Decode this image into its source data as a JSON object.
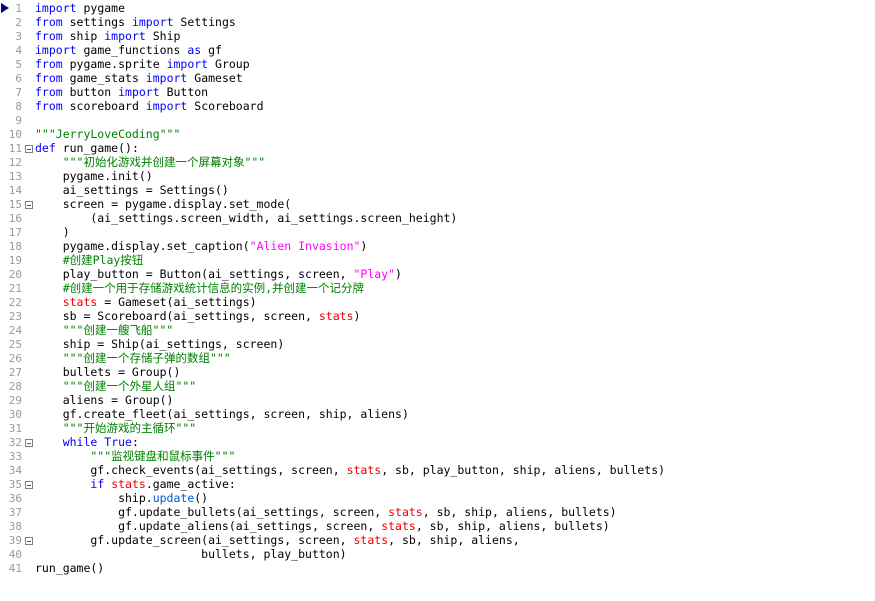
{
  "editor": {
    "language": "Python",
    "total_lines": 41,
    "colors": {
      "background": "#ffffff",
      "line_number": "#999999",
      "keyword": "#0000ff",
      "string": "#ff00ff",
      "comment": "#008000",
      "error_highlight": "#ee0000",
      "method": "#0055dd",
      "plain_text": "#000000",
      "breakpoint_arrow": "#000080"
    },
    "markers": {
      "current_line_arrow": 1,
      "fold_lines": [
        11,
        15,
        32,
        35,
        39
      ]
    },
    "lines": [
      {
        "n": 1,
        "fold": false,
        "tokens": [
          {
            "t": "import",
            "c": "kw"
          },
          {
            "t": " pygame",
            "c": "pln"
          }
        ]
      },
      {
        "n": 2,
        "fold": false,
        "tokens": [
          {
            "t": "from",
            "c": "kw"
          },
          {
            "t": " settings ",
            "c": "pln"
          },
          {
            "t": "import",
            "c": "kw"
          },
          {
            "t": " Settings",
            "c": "pln"
          }
        ]
      },
      {
        "n": 3,
        "fold": false,
        "tokens": [
          {
            "t": "from",
            "c": "kw"
          },
          {
            "t": " ship ",
            "c": "pln"
          },
          {
            "t": "import",
            "c": "kw"
          },
          {
            "t": " Ship",
            "c": "pln"
          }
        ]
      },
      {
        "n": 4,
        "fold": false,
        "tokens": [
          {
            "t": "import",
            "c": "kw"
          },
          {
            "t": " game_functions ",
            "c": "pln"
          },
          {
            "t": "as",
            "c": "kw"
          },
          {
            "t": " gf",
            "c": "pln"
          }
        ]
      },
      {
        "n": 5,
        "fold": false,
        "tokens": [
          {
            "t": "from",
            "c": "kw"
          },
          {
            "t": " pygame.sprite ",
            "c": "pln"
          },
          {
            "t": "import",
            "c": "kw"
          },
          {
            "t": " Group",
            "c": "pln"
          }
        ]
      },
      {
        "n": 6,
        "fold": false,
        "tokens": [
          {
            "t": "from",
            "c": "kw"
          },
          {
            "t": " game_stats ",
            "c": "pln"
          },
          {
            "t": "import",
            "c": "kw"
          },
          {
            "t": " Gameset",
            "c": "pln"
          }
        ]
      },
      {
        "n": 7,
        "fold": false,
        "tokens": [
          {
            "t": "from",
            "c": "kw"
          },
          {
            "t": " button ",
            "c": "pln"
          },
          {
            "t": "import",
            "c": "kw"
          },
          {
            "t": " Button",
            "c": "pln"
          }
        ]
      },
      {
        "n": 8,
        "fold": false,
        "tokens": [
          {
            "t": "from",
            "c": "kw"
          },
          {
            "t": " scoreboard ",
            "c": "pln"
          },
          {
            "t": "import",
            "c": "kw"
          },
          {
            "t": " Scoreboard",
            "c": "pln"
          }
        ]
      },
      {
        "n": 9,
        "fold": false,
        "tokens": []
      },
      {
        "n": 10,
        "fold": false,
        "tokens": [
          {
            "t": "\"\"\"JerryLoveCoding\"\"\"",
            "c": "doc"
          }
        ]
      },
      {
        "n": 11,
        "fold": true,
        "tokens": [
          {
            "t": "def",
            "c": "kw"
          },
          {
            "t": " run_game():",
            "c": "pln"
          }
        ]
      },
      {
        "n": 12,
        "fold": false,
        "tokens": [
          {
            "t": "    \"\"\"初始化游戏并创建一个屏幕对象\"\"\"",
            "c": "doc"
          }
        ]
      },
      {
        "n": 13,
        "fold": false,
        "tokens": [
          {
            "t": "    pygame.init()",
            "c": "pln"
          }
        ]
      },
      {
        "n": 14,
        "fold": false,
        "tokens": [
          {
            "t": "    ai_settings = Settings()",
            "c": "pln"
          }
        ]
      },
      {
        "n": 15,
        "fold": true,
        "tokens": [
          {
            "t": "    screen = pygame.display.set_mode(",
            "c": "pln"
          }
        ]
      },
      {
        "n": 16,
        "fold": false,
        "tokens": [
          {
            "t": "        (ai_settings.screen_width, ai_settings.screen_height)",
            "c": "pln"
          }
        ]
      },
      {
        "n": 17,
        "fold": false,
        "tokens": [
          {
            "t": "    )",
            "c": "pln"
          }
        ]
      },
      {
        "n": 18,
        "fold": false,
        "tokens": [
          {
            "t": "    pygame.display.set_caption(",
            "c": "pln"
          },
          {
            "t": "\"Alien Invasion\"",
            "c": "str"
          },
          {
            "t": ")",
            "c": "pln"
          }
        ]
      },
      {
        "n": 19,
        "fold": false,
        "tokens": [
          {
            "t": "    #创建Play按钮",
            "c": "cmt"
          }
        ]
      },
      {
        "n": 20,
        "fold": false,
        "tokens": [
          {
            "t": "    play_button = Button(ai_settings, screen, ",
            "c": "pln"
          },
          {
            "t": "\"Play\"",
            "c": "str"
          },
          {
            "t": ")",
            "c": "pln"
          }
        ]
      },
      {
        "n": 21,
        "fold": false,
        "tokens": [
          {
            "t": "    #创建一个用于存储游戏统计信息的实例,并创建一个记分牌",
            "c": "cmt"
          }
        ]
      },
      {
        "n": 22,
        "fold": false,
        "tokens": [
          {
            "t": "    ",
            "c": "pln"
          },
          {
            "t": "stats",
            "c": "err"
          },
          {
            "t": " = Gameset(ai_settings)",
            "c": "pln"
          }
        ]
      },
      {
        "n": 23,
        "fold": false,
        "tokens": [
          {
            "t": "    sb = Scoreboard(ai_settings, screen, ",
            "c": "pln"
          },
          {
            "t": "stats",
            "c": "err"
          },
          {
            "t": ")",
            "c": "pln"
          }
        ]
      },
      {
        "n": 24,
        "fold": false,
        "tokens": [
          {
            "t": "    \"\"\"创建一艘飞船\"\"\"",
            "c": "doc"
          }
        ]
      },
      {
        "n": 25,
        "fold": false,
        "tokens": [
          {
            "t": "    ship = Ship(ai_settings, screen)",
            "c": "pln"
          }
        ]
      },
      {
        "n": 26,
        "fold": false,
        "tokens": [
          {
            "t": "    \"\"\"创建一个存储子弹的数组\"\"\"",
            "c": "doc"
          }
        ]
      },
      {
        "n": 27,
        "fold": false,
        "tokens": [
          {
            "t": "    bullets = Group()",
            "c": "pln"
          }
        ]
      },
      {
        "n": 28,
        "fold": false,
        "tokens": [
          {
            "t": "    \"\"\"创建一个外星人组\"\"\"",
            "c": "doc"
          }
        ]
      },
      {
        "n": 29,
        "fold": false,
        "tokens": [
          {
            "t": "    aliens = Group()",
            "c": "pln"
          }
        ]
      },
      {
        "n": 30,
        "fold": false,
        "tokens": [
          {
            "t": "    gf.create_fleet(ai_settings, screen, ship, aliens)",
            "c": "pln"
          }
        ]
      },
      {
        "n": 31,
        "fold": false,
        "tokens": [
          {
            "t": "    \"\"\"开始游戏的主循环\"\"\"",
            "c": "doc"
          }
        ]
      },
      {
        "n": 32,
        "fold": true,
        "tokens": [
          {
            "t": "    ",
            "c": "pln"
          },
          {
            "t": "while",
            "c": "kw"
          },
          {
            "t": " ",
            "c": "pln"
          },
          {
            "t": "True",
            "c": "kw"
          },
          {
            "t": ":",
            "c": "pln"
          }
        ]
      },
      {
        "n": 33,
        "fold": false,
        "tokens": [
          {
            "t": "        \"\"\"监视键盘和鼠标事件\"\"\"",
            "c": "doc"
          }
        ]
      },
      {
        "n": 34,
        "fold": false,
        "tokens": [
          {
            "t": "        gf.check_events(ai_settings, screen, ",
            "c": "pln"
          },
          {
            "t": "stats",
            "c": "err"
          },
          {
            "t": ", sb, play_button, ship, aliens, bullets)",
            "c": "pln"
          }
        ]
      },
      {
        "n": 35,
        "fold": true,
        "tokens": [
          {
            "t": "        ",
            "c": "pln"
          },
          {
            "t": "if",
            "c": "kw"
          },
          {
            "t": " ",
            "c": "pln"
          },
          {
            "t": "stats",
            "c": "err"
          },
          {
            "t": ".game_active:",
            "c": "pln"
          }
        ]
      },
      {
        "n": 36,
        "fold": false,
        "tokens": [
          {
            "t": "            ship.",
            "c": "pln"
          },
          {
            "t": "update",
            "c": "meth"
          },
          {
            "t": "()",
            "c": "pln"
          }
        ]
      },
      {
        "n": 37,
        "fold": false,
        "tokens": [
          {
            "t": "            gf.update_bullets(ai_settings, screen, ",
            "c": "pln"
          },
          {
            "t": "stats",
            "c": "err"
          },
          {
            "t": ", sb, ship, aliens, bullets)",
            "c": "pln"
          }
        ]
      },
      {
        "n": 38,
        "fold": false,
        "tokens": [
          {
            "t": "            gf.update_aliens(ai_settings, screen, ",
            "c": "pln"
          },
          {
            "t": "stats",
            "c": "err"
          },
          {
            "t": ", sb, ship, aliens, bullets)",
            "c": "pln"
          }
        ]
      },
      {
        "n": 39,
        "fold": true,
        "tokens": [
          {
            "t": "        gf.update_screen(ai_settings, screen, ",
            "c": "pln"
          },
          {
            "t": "stats",
            "c": "err"
          },
          {
            "t": ", sb, ship, aliens,",
            "c": "pln"
          }
        ]
      },
      {
        "n": 40,
        "fold": false,
        "tokens": [
          {
            "t": "                        bullets, play_button)",
            "c": "pln"
          }
        ]
      },
      {
        "n": 41,
        "fold": false,
        "tokens": [
          {
            "t": "run_game()",
            "c": "pln"
          }
        ]
      }
    ]
  }
}
